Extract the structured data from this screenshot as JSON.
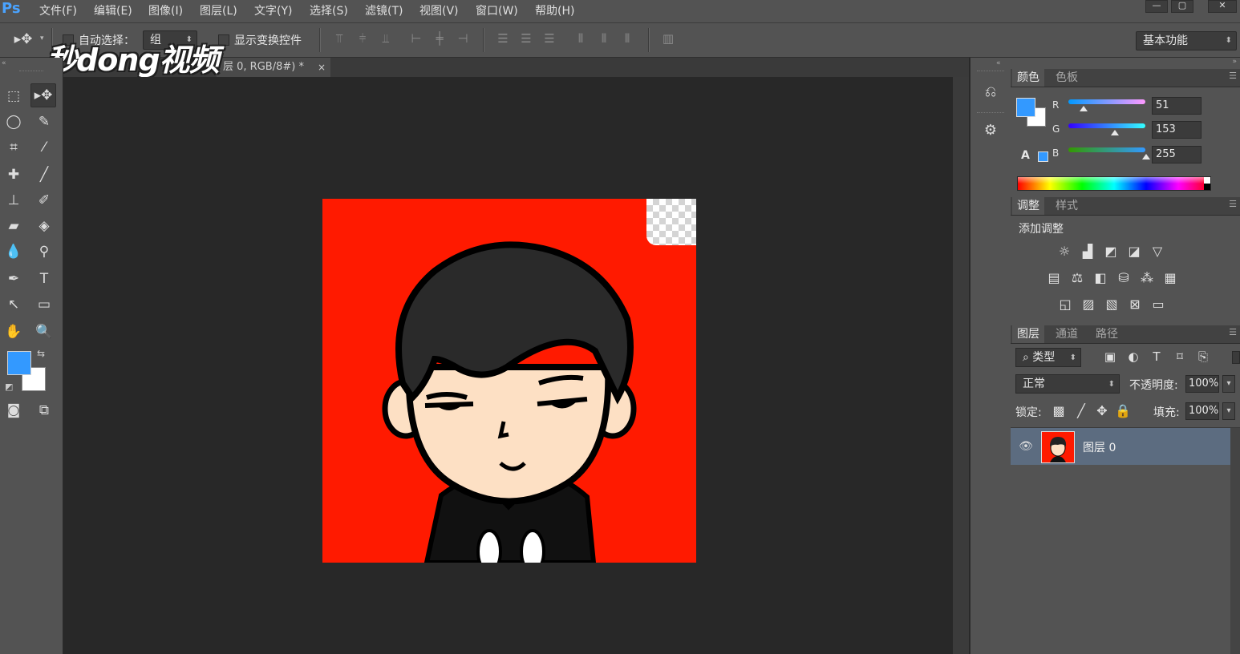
{
  "app": {
    "logo": "Ps"
  },
  "menu": [
    "文件(F)",
    "编辑(E)",
    "图像(I)",
    "图层(L)",
    "文字(Y)",
    "选择(S)",
    "滤镜(T)",
    "视图(V)",
    "窗口(W)",
    "帮助(H)"
  ],
  "window_buttons": [
    "—",
    "▢",
    "✕"
  ],
  "options": {
    "auto_select_label": "自动选择：",
    "auto_select_value": "组",
    "show_transform_label": "显示变换控件",
    "workspace": "基本功能"
  },
  "watermark": "秒dong视频",
  "document_tab": {
    "title": "层 0, RGB/8#) *",
    "close": "×"
  },
  "colors": {
    "foreground": "#3399ff",
    "background": "#ffffff",
    "image_background": "#ff1a00"
  },
  "color_panel": {
    "tabs": [
      "颜色",
      "色板"
    ],
    "channels": [
      {
        "label": "R",
        "value": "51"
      },
      {
        "label": "G",
        "value": "153"
      },
      {
        "label": "B",
        "value": "255"
      }
    ]
  },
  "adjustments_panel": {
    "tabs": [
      "调整",
      "样式"
    ],
    "heading": "添加调整",
    "icons": [
      [
        "brightness-icon",
        "levels-icon",
        "curves-icon",
        "exposure-icon",
        "vibrance-icon"
      ],
      [
        "hue-saturation-icon",
        "color-balance-icon",
        "black-white-icon",
        "photo-filter-icon",
        "channel-mixer-icon",
        "color-lookup-icon"
      ],
      [
        "invert-icon",
        "posterize-icon",
        "threshold-icon",
        "selective-color-icon",
        "gradient-map-icon"
      ]
    ]
  },
  "layers_panel": {
    "tabs": [
      "图层",
      "通道",
      "路径"
    ],
    "filter_kind": "类型",
    "blend_mode": "正常",
    "opacity_label": "不透明度:",
    "opacity": "100%",
    "lock_label": "锁定:",
    "fill_label": "填充:",
    "fill": "100%",
    "layers": [
      {
        "name": "图层 0",
        "visible": true
      }
    ]
  }
}
